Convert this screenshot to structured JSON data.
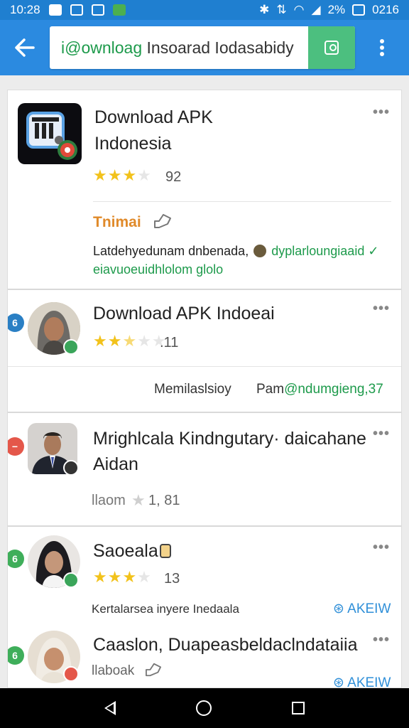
{
  "status_bar": {
    "time": "10:28",
    "battery_text": "2%",
    "clock_right": "0216"
  },
  "app_bar": {
    "search_value_prefix": "i@ownloag",
    "search_value_rest": " Insoarad Iodasabidy",
    "back_icon": "arrow-left-icon",
    "search_icon": "search-icon",
    "menu_icon": "more-vert-icon"
  },
  "colors": {
    "accent": "#2b8ae0",
    "status": "#1f7fd0",
    "search_button": "#4cbf7f",
    "star": "#f2c21b",
    "link_green": "#1d9a4b",
    "link_blue": "#2f8fd8"
  },
  "items": [
    {
      "title_line1": "Download APK",
      "title_line2": "Indonesia",
      "stars": 3,
      "rating": "92",
      "tag": "Tnimai",
      "desc_line1": "Latdehyedunam dnbenada,",
      "desc_green1": "dyplarloungiaaid",
      "desc_line2": "eiavuoeuidhlolom glolo"
    },
    {
      "title_line1": "Download APK Indoeai",
      "stars": 2.5,
      "rating": ".11",
      "footer_left": "Memilaslsioy",
      "footer_prefix": "Pam",
      "footer_green": "@ndumgieng,37"
    },
    {
      "title_line1": "Mrighlcala Kindngutary· daicahane",
      "title_line2": "Aidan",
      "rating_label": "llaom",
      "rating": "1, 81"
    },
    {
      "title_line1": "Saoeala",
      "stars": 3,
      "rating": "13",
      "desc": "Kertalarsea inyere Inedaala",
      "action": "AKEIW"
    },
    {
      "title_line1": "Caaslon, Duapeasbeldaclndataiia",
      "meta": "llaboak",
      "action": "AKEIW"
    }
  ]
}
